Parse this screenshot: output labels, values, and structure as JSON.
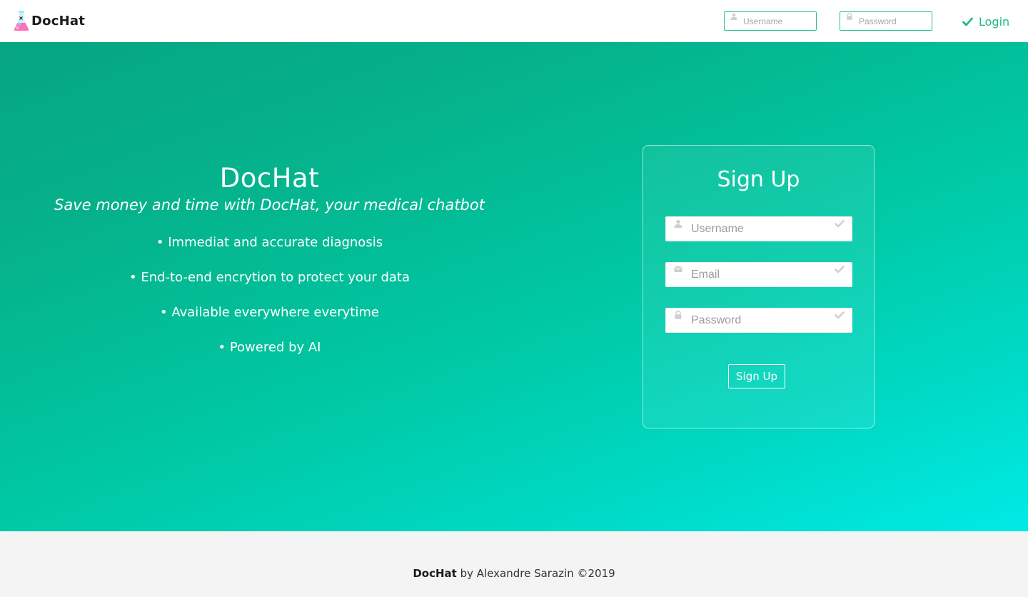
{
  "navbar": {
    "brand_name": "DocHat",
    "username_placeholder": "Username",
    "password_placeholder": "Password",
    "login_label": "Login"
  },
  "hero": {
    "title": "DocHat",
    "tagline": "Save money and time with DocHat, your medical chatbot",
    "features": [
      "• Immediat and accurate diagnosis",
      "• End-to-end encrytion to protect your data",
      "• Available everywhere everytime",
      "• Powered by AI"
    ]
  },
  "signup": {
    "title": "Sign Up",
    "username_placeholder": "Username",
    "email_placeholder": "Email",
    "password_placeholder": "Password",
    "button_label": "Sign Up"
  },
  "footer": {
    "brand": "DocHat",
    "credit": " by Alexandre Sarazin ©2019"
  },
  "colors": {
    "accent": "#1fb88c",
    "gradient_start": "#06a582",
    "gradient_end": "#00eae6",
    "footer_bg": "#f4f4f4"
  },
  "icons": [
    "flask-logo-icon",
    "user-icon",
    "lock-icon",
    "envelope-icon",
    "check-icon"
  ]
}
